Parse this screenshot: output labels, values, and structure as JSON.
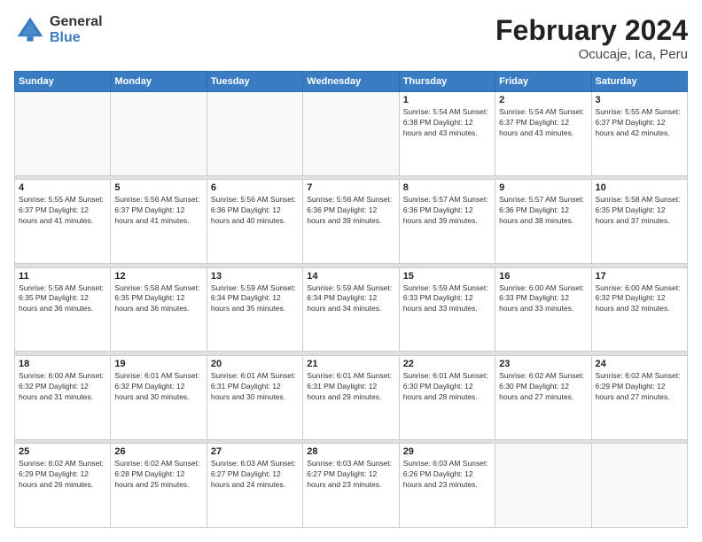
{
  "header": {
    "logo_general": "General",
    "logo_blue": "Blue",
    "title": "February 2024",
    "subtitle": "Ocucaje, Ica, Peru"
  },
  "weekdays": [
    "Sunday",
    "Monday",
    "Tuesday",
    "Wednesday",
    "Thursday",
    "Friday",
    "Saturday"
  ],
  "weeks": [
    [
      {
        "day": "",
        "info": ""
      },
      {
        "day": "",
        "info": ""
      },
      {
        "day": "",
        "info": ""
      },
      {
        "day": "",
        "info": ""
      },
      {
        "day": "1",
        "info": "Sunrise: 5:54 AM\nSunset: 6:38 PM\nDaylight: 12 hours\nand 43 minutes."
      },
      {
        "day": "2",
        "info": "Sunrise: 5:54 AM\nSunset: 6:37 PM\nDaylight: 12 hours\nand 43 minutes."
      },
      {
        "day": "3",
        "info": "Sunrise: 5:55 AM\nSunset: 6:37 PM\nDaylight: 12 hours\nand 42 minutes."
      }
    ],
    [
      {
        "day": "4",
        "info": "Sunrise: 5:55 AM\nSunset: 6:37 PM\nDaylight: 12 hours\nand 41 minutes."
      },
      {
        "day": "5",
        "info": "Sunrise: 5:56 AM\nSunset: 6:37 PM\nDaylight: 12 hours\nand 41 minutes."
      },
      {
        "day": "6",
        "info": "Sunrise: 5:56 AM\nSunset: 6:36 PM\nDaylight: 12 hours\nand 40 minutes."
      },
      {
        "day": "7",
        "info": "Sunrise: 5:56 AM\nSunset: 6:36 PM\nDaylight: 12 hours\nand 39 minutes."
      },
      {
        "day": "8",
        "info": "Sunrise: 5:57 AM\nSunset: 6:36 PM\nDaylight: 12 hours\nand 39 minutes."
      },
      {
        "day": "9",
        "info": "Sunrise: 5:57 AM\nSunset: 6:36 PM\nDaylight: 12 hours\nand 38 minutes."
      },
      {
        "day": "10",
        "info": "Sunrise: 5:58 AM\nSunset: 6:35 PM\nDaylight: 12 hours\nand 37 minutes."
      }
    ],
    [
      {
        "day": "11",
        "info": "Sunrise: 5:58 AM\nSunset: 6:35 PM\nDaylight: 12 hours\nand 36 minutes."
      },
      {
        "day": "12",
        "info": "Sunrise: 5:58 AM\nSunset: 6:35 PM\nDaylight: 12 hours\nand 36 minutes."
      },
      {
        "day": "13",
        "info": "Sunrise: 5:59 AM\nSunset: 6:34 PM\nDaylight: 12 hours\nand 35 minutes."
      },
      {
        "day": "14",
        "info": "Sunrise: 5:59 AM\nSunset: 6:34 PM\nDaylight: 12 hours\nand 34 minutes."
      },
      {
        "day": "15",
        "info": "Sunrise: 5:59 AM\nSunset: 6:33 PM\nDaylight: 12 hours\nand 33 minutes."
      },
      {
        "day": "16",
        "info": "Sunrise: 6:00 AM\nSunset: 6:33 PM\nDaylight: 12 hours\nand 33 minutes."
      },
      {
        "day": "17",
        "info": "Sunrise: 6:00 AM\nSunset: 6:32 PM\nDaylight: 12 hours\nand 32 minutes."
      }
    ],
    [
      {
        "day": "18",
        "info": "Sunrise: 6:00 AM\nSunset: 6:32 PM\nDaylight: 12 hours\nand 31 minutes."
      },
      {
        "day": "19",
        "info": "Sunrise: 6:01 AM\nSunset: 6:32 PM\nDaylight: 12 hours\nand 30 minutes."
      },
      {
        "day": "20",
        "info": "Sunrise: 6:01 AM\nSunset: 6:31 PM\nDaylight: 12 hours\nand 30 minutes."
      },
      {
        "day": "21",
        "info": "Sunrise: 6:01 AM\nSunset: 6:31 PM\nDaylight: 12 hours\nand 29 minutes."
      },
      {
        "day": "22",
        "info": "Sunrise: 6:01 AM\nSunset: 6:30 PM\nDaylight: 12 hours\nand 28 minutes."
      },
      {
        "day": "23",
        "info": "Sunrise: 6:02 AM\nSunset: 6:30 PM\nDaylight: 12 hours\nand 27 minutes."
      },
      {
        "day": "24",
        "info": "Sunrise: 6:02 AM\nSunset: 6:29 PM\nDaylight: 12 hours\nand 27 minutes."
      }
    ],
    [
      {
        "day": "25",
        "info": "Sunrise: 6:02 AM\nSunset: 6:29 PM\nDaylight: 12 hours\nand 26 minutes."
      },
      {
        "day": "26",
        "info": "Sunrise: 6:02 AM\nSunset: 6:28 PM\nDaylight: 12 hours\nand 25 minutes."
      },
      {
        "day": "27",
        "info": "Sunrise: 6:03 AM\nSunset: 6:27 PM\nDaylight: 12 hours\nand 24 minutes."
      },
      {
        "day": "28",
        "info": "Sunrise: 6:03 AM\nSunset: 6:27 PM\nDaylight: 12 hours\nand 23 minutes."
      },
      {
        "day": "29",
        "info": "Sunrise: 6:03 AM\nSunset: 6:26 PM\nDaylight: 12 hours\nand 23 minutes."
      },
      {
        "day": "",
        "info": ""
      },
      {
        "day": "",
        "info": ""
      }
    ]
  ]
}
